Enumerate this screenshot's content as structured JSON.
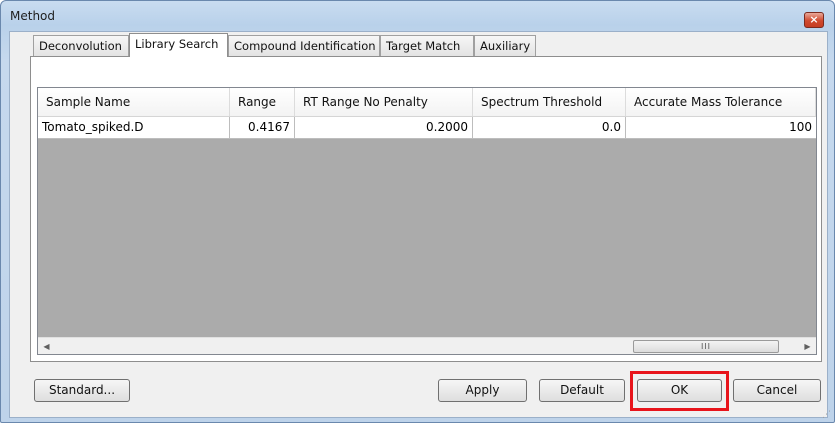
{
  "window": {
    "title": "Method",
    "close_icon": "×"
  },
  "tabs": [
    {
      "label": "Deconvolution",
      "active": false
    },
    {
      "label": "Library Search",
      "active": true
    },
    {
      "label": "Compound Identification",
      "active": false
    },
    {
      "label": "Target Match",
      "active": false
    },
    {
      "label": "Auxiliary",
      "active": false
    }
  ],
  "table": {
    "columns": [
      "Sample Name",
      "Range",
      "RT Range No Penalty",
      "Spectrum Threshold",
      "Accurate Mass Tolerance"
    ],
    "rows": [
      [
        "Tomato_spiked.D",
        "0.4167",
        "0.2000",
        "0.0",
        "100"
      ]
    ]
  },
  "scrollbar": {
    "left_arrow": "◀",
    "right_arrow": "▶",
    "thumb_grip": "III"
  },
  "buttons": {
    "standard": "Standard...",
    "apply": "Apply",
    "default": "Default",
    "ok": "OK",
    "cancel": "Cancel"
  },
  "colors": {
    "highlight": "#e8141b",
    "grid_background": "#ababab",
    "titlebar": "#b9d1ea"
  }
}
